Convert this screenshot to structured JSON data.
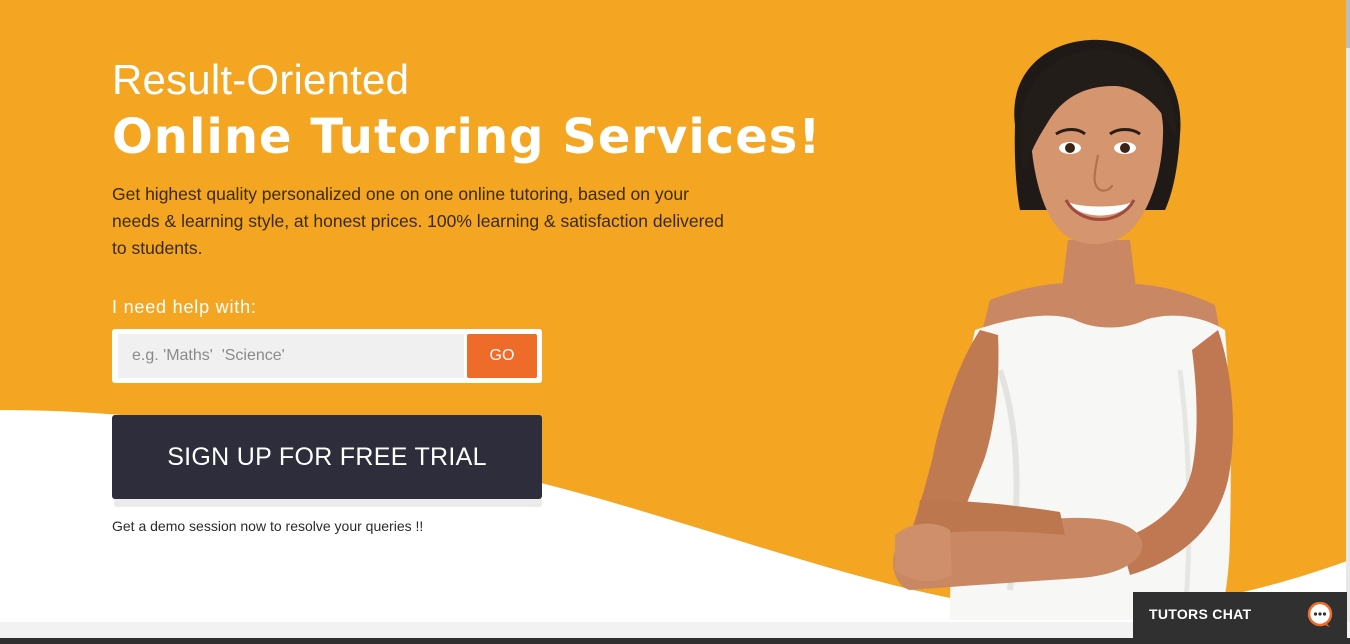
{
  "hero": {
    "subtitle": "Result-Oriented",
    "title": "Online Tutoring Services!",
    "description": "Get highest quality personalized one on one online tutoring, based on your needs & learning style, at honest prices. 100% learning & satisfaction delivered to students.",
    "help_label": "I need help with:"
  },
  "search": {
    "placeholder": "e.g. 'Maths'  'Science'",
    "value": "",
    "button_label": "GO"
  },
  "cta": {
    "signup_label": "SIGN UP FOR FREE TRIAL",
    "demo_note": "Get a demo session now to resolve your queries !!"
  },
  "chat": {
    "label": "TUTORS CHAT",
    "icon": "chat-bubble-icon"
  },
  "colors": {
    "hero_orange": "#F4A622",
    "go_button": "#EE6B2A",
    "signup_button": "#2D2D3C",
    "chat_widget": "#303030"
  }
}
